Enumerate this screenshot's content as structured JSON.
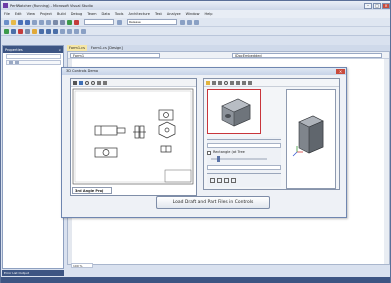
{
  "app": {
    "title": "PerfWatcher (Running) - Microsoft Visual Studio",
    "menu": [
      "File",
      "Edit",
      "View",
      "Project",
      "Build",
      "Debug",
      "Team",
      "Data",
      "Tools",
      "Architecture",
      "Test",
      "Analyze",
      "Window",
      "Help"
    ],
    "toolbar_dropdown_value": "Release"
  },
  "properties_panel": {
    "title": "Properties"
  },
  "document_tabs": [
    {
      "label": "Form1.cs",
      "active": true
    },
    {
      "label": "Form1.cs [Design]",
      "active": false
    }
  ],
  "editor": {
    "class_combo": "Form1",
    "member_combo": "IDocEmbedded"
  },
  "dialog": {
    "title": "3D Controls Demo",
    "drawing_tab": "3rd Angle Proj",
    "setting_text": "Rectangle (at Tree",
    "load_button": "Load Draft and Part Files in Controls"
  },
  "bottom": {
    "tabs_text": "Error List   Output",
    "zoom": "100 %"
  },
  "colors": {
    "accent": "#3d5583",
    "selection_red": "#c8353b"
  }
}
